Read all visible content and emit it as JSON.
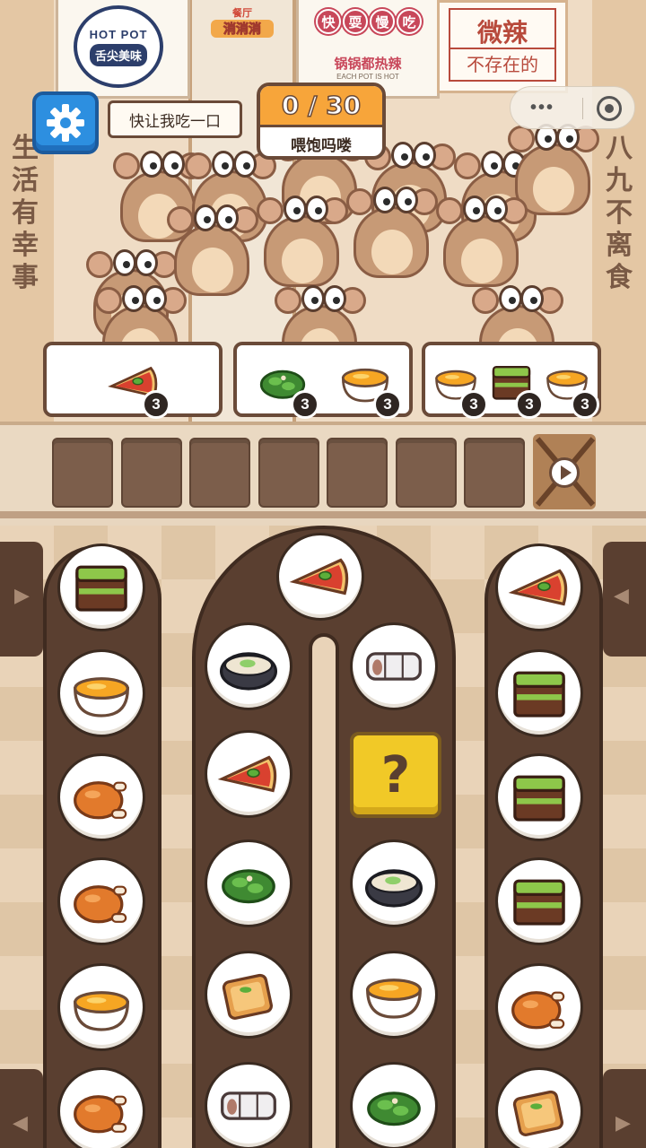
{
  "scene": {
    "sign_hotpot_top": "HOT POT",
    "sign_hotpot_band": "舌尖美味",
    "logo_line1": "餐厅",
    "logo_line2": "消消消",
    "pills": [
      "快",
      "耍",
      "慢",
      "吃"
    ],
    "hot_slogan": "锅锅都热辣",
    "hot_slogan_en": "EACH POT IS HOT",
    "spicy_top": "微辣",
    "spicy_bottom": "不存在的",
    "left_vertical": "生活有幸事",
    "right_vertical": "八九不离食",
    "capsule_dots": "•••"
  },
  "hud": {
    "hint_text": "快让我吃一口",
    "counter_value": "0 / 30",
    "counter_label": "喂饱吗喽"
  },
  "orders": [
    {
      "items": [
        {
          "food": "pizza-slice",
          "count": "3"
        }
      ]
    },
    {
      "items": [
        {
          "food": "greens",
          "count": "3"
        },
        {
          "food": "pudding-bowl",
          "count": "3"
        }
      ]
    },
    {
      "items": [
        {
          "food": "pudding-bowl",
          "count": "3"
        },
        {
          "food": "matcha-cake",
          "count": "3"
        },
        {
          "food": "pudding-bowl",
          "count": "3"
        }
      ]
    }
  ],
  "tray": {
    "slot_count": 7,
    "slots_filled": 0
  },
  "board": {
    "left_lane": [
      "matcha-cake",
      "pudding-bowl",
      "roast-chicken",
      "roast-chicken",
      "pudding-bowl",
      "roast-chicken"
    ],
    "middle_top": "pizza-slice",
    "middle_left": [
      "soup-pot",
      "pizza-slice",
      "greens",
      "toast",
      "rice-roll"
    ],
    "middle_right": [
      "rice-roll",
      "mystery",
      "soup-pot",
      "pudding-bowl",
      "greens"
    ],
    "right_lane": [
      "pizza-slice",
      "matcha-cake",
      "matcha-cake",
      "matcha-cake",
      "roast-chicken",
      "toast"
    ],
    "mystery_label": "?"
  },
  "colors": {
    "belt": "#5a3f30",
    "counter_accent": "#f7a53a",
    "settings_blue": "#2d8fe0",
    "mystery_yellow": "#f1c927"
  }
}
